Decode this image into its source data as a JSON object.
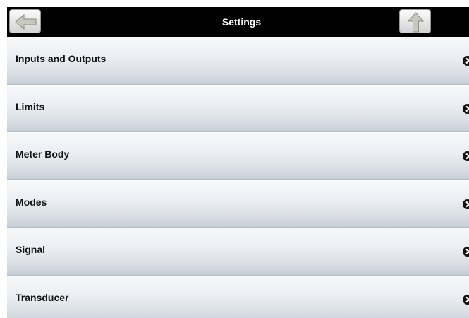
{
  "header": {
    "title": "Settings",
    "back_icon": "left-arrow-icon",
    "up_icon": "up-arrow-icon"
  },
  "menu": {
    "items": [
      {
        "label": "Inputs and Outputs",
        "icon": "chevron-right-circle-icon"
      },
      {
        "label": "Limits",
        "icon": "chevron-right-circle-icon"
      },
      {
        "label": "Meter Body",
        "icon": "chevron-right-circle-icon"
      },
      {
        "label": "Modes",
        "icon": "chevron-right-circle-icon"
      },
      {
        "label": "Signal",
        "icon": "chevron-right-circle-icon"
      },
      {
        "label": "Transducer",
        "icon": "chevron-right-circle-icon"
      }
    ]
  },
  "colors": {
    "header_background": "#000000",
    "header_text": "#ffffff",
    "item_text": "#111111",
    "item_gradient_top": "#f7f8fa",
    "item_gradient_bottom": "#c7ced7"
  }
}
